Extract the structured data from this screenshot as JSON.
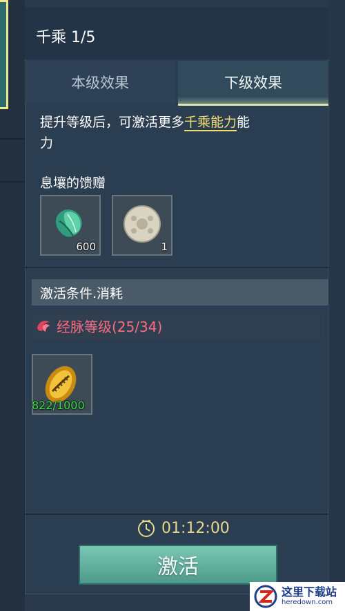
{
  "panel": {
    "title": "千乘 1/5",
    "tabs": [
      "本级效果",
      "下级效果"
    ],
    "active_tab": "下级效果",
    "description_prefix": "提升等级后，可激活更多",
    "description_highlight": "千乘能力",
    "description_suffix": "能力",
    "description_wrap": "力",
    "gift_label": "息壤的馈赠",
    "gift_items": [
      {
        "icon": "jade-leaf-icon",
        "count": "600"
      },
      {
        "icon": "jade-disc-icon",
        "count": "1"
      }
    ],
    "condition_header": "激活条件.消耗",
    "requirement": {
      "icon": "meridian-icon",
      "text": "经脉等级(25/34)"
    },
    "cost_item": {
      "icon": "golden-shell-icon",
      "count": "822/1000"
    },
    "timer": "01:12:00",
    "activate_label": "激活"
  },
  "watermark": {
    "cn": "这里下载站",
    "en": "heredown.com"
  },
  "colors": {
    "highlight": "#f3dc6b",
    "requirement_text": "#ff6a83",
    "cost_count": "#3de04b",
    "timer_text": "#e8d98a",
    "button": "#5fae9d"
  }
}
